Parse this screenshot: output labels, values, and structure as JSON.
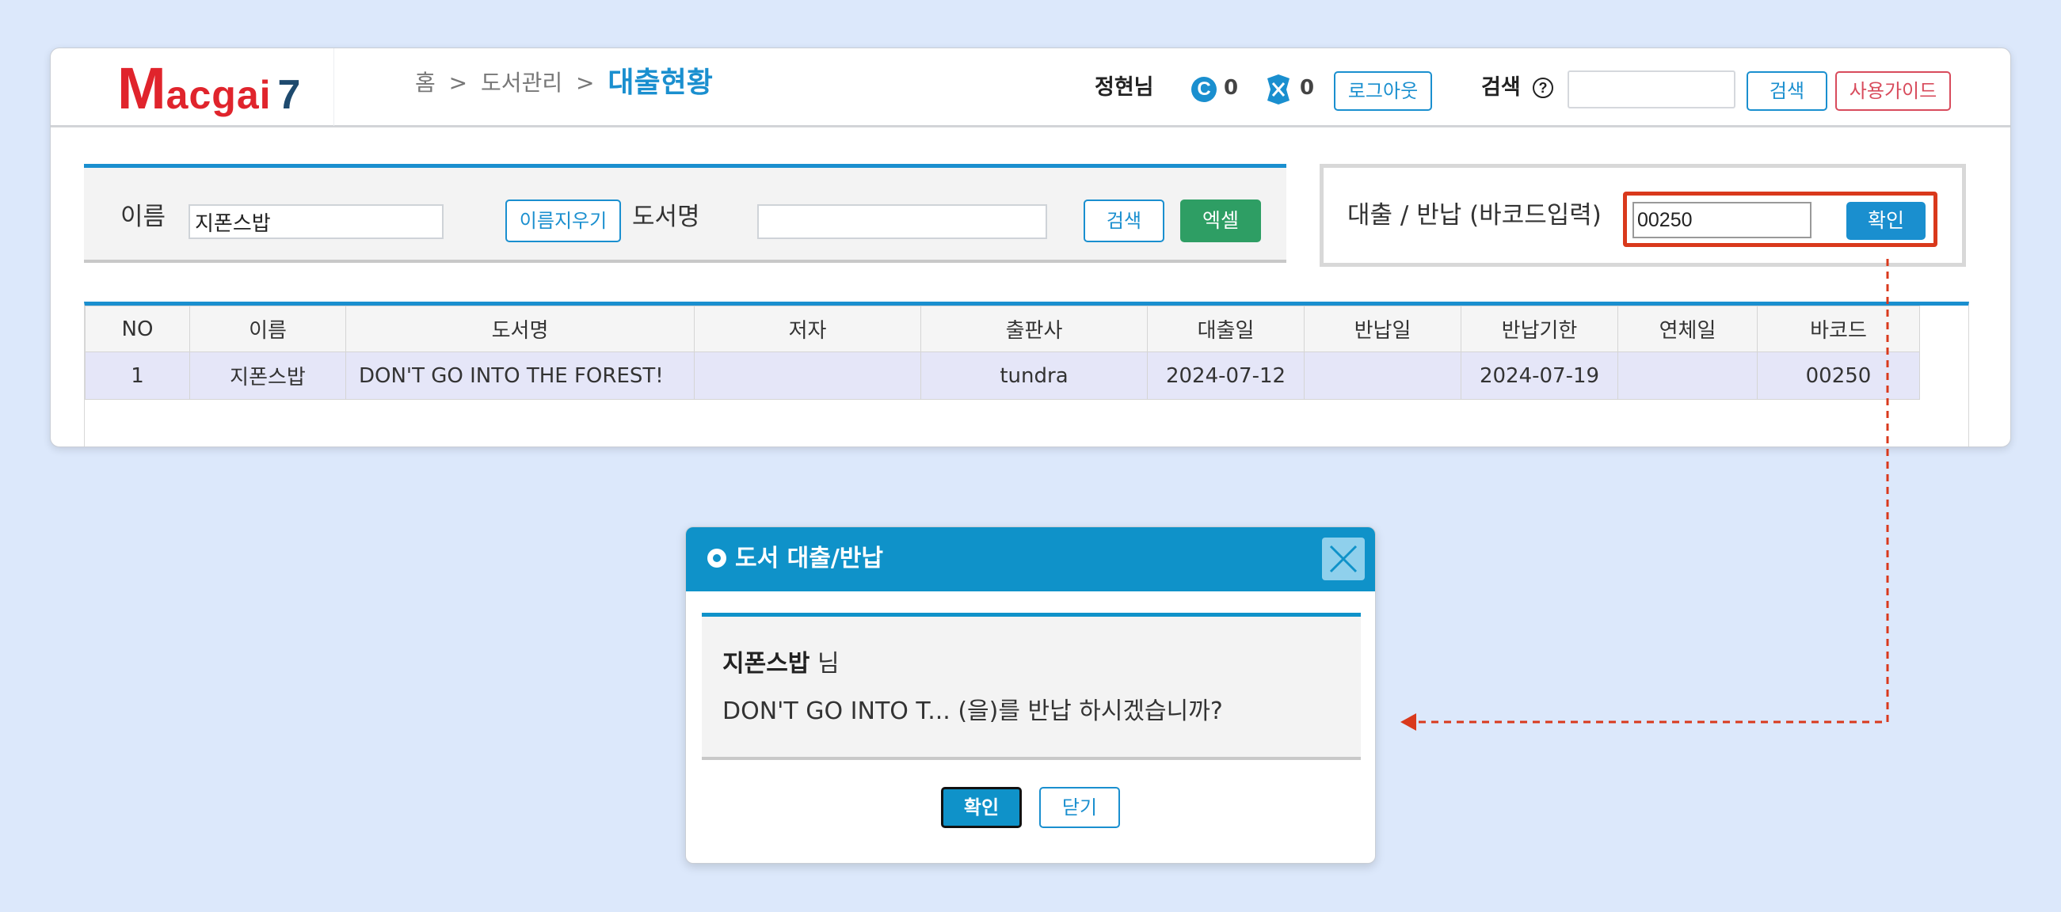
{
  "logo": {
    "m": "M",
    "rest": "acgai",
    "num": "7"
  },
  "breadcrumb": {
    "home": "홈",
    "section": "도서관리",
    "current": "대출현황",
    "sep": ">"
  },
  "header": {
    "user": "정현님",
    "coin_icon": "C",
    "coin_count": "0",
    "ticket_count": "0",
    "logout": "로그아웃",
    "search_label": "검색",
    "help_icon": "?",
    "search_value": "",
    "search_button": "검색",
    "guide_button": "사용가이드"
  },
  "filter": {
    "name_label": "이름",
    "name_value": "지폰스밥",
    "clear_button": "이름지우기",
    "title_label": "도서명",
    "title_value": "",
    "search_button": "검색",
    "excel_button": "엑셀"
  },
  "barcode": {
    "label": "대출 / 반납 (바코드입력)",
    "value": "00250",
    "confirm": "확인"
  },
  "table": {
    "headers": [
      "NO",
      "이름",
      "도서명",
      "저자",
      "출판사",
      "대출일",
      "반납일",
      "반납기한",
      "연체일",
      "바코드"
    ],
    "rows": [
      [
        "1",
        "지폰스밥",
        "DON'T GO INTO THE FOREST!",
        "",
        "tundra",
        "2024-07-12",
        "",
        "2024-07-19",
        "",
        "00250"
      ]
    ]
  },
  "dialog": {
    "title": "도서 대출/반납",
    "user_name": "지폰스밥",
    "honorific": " 님",
    "message": "DON'T GO INTO T... (을)를 반납 하시겠습니까?",
    "confirm": "확인",
    "close": "닫기"
  },
  "colors": {
    "accent": "#1a8fcf",
    "dialog_header": "#0f92c9",
    "excel": "#2e9e64",
    "highlight": "#d9391c",
    "logo_red": "#e0242c",
    "logo_navy": "#1e4a6e",
    "guide_red": "#d84b5c",
    "background": "#dce8fb"
  }
}
